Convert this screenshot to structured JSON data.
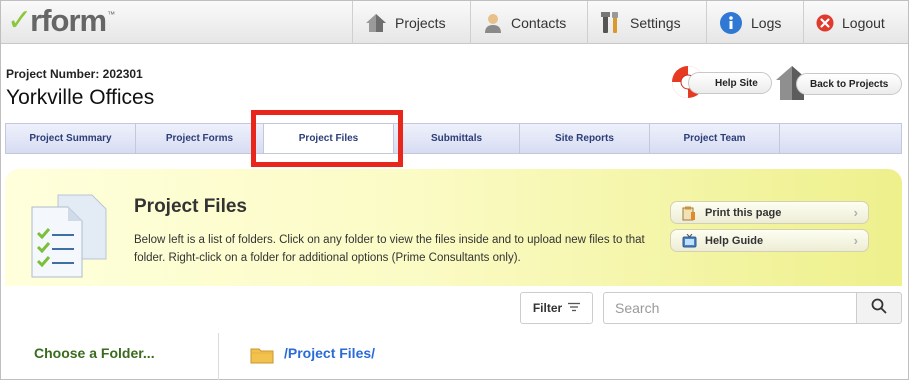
{
  "app": {
    "logo_text": "rform",
    "logo_tm": "™"
  },
  "nav": {
    "items": [
      {
        "label": "Projects",
        "icon": "house-icon"
      },
      {
        "label": "Contacts",
        "icon": "user-icon"
      },
      {
        "label": "Settings",
        "icon": "tools-icon"
      },
      {
        "label": "Logs",
        "icon": "info-icon"
      },
      {
        "label": "Logout",
        "icon": "close-circle-icon"
      }
    ]
  },
  "project": {
    "number_label": "Project Number: 202301",
    "name": "Yorkville Offices"
  },
  "header_buttons": {
    "help_site": "Help Site",
    "back_to_projects": "Back to Projects"
  },
  "tabs": [
    {
      "label": "Project Summary"
    },
    {
      "label": "Project Forms"
    },
    {
      "label": "Project Files",
      "active": true
    },
    {
      "label": "Submittals"
    },
    {
      "label": "Site Reports"
    },
    {
      "label": "Project Team"
    }
  ],
  "panel": {
    "title": "Project Files",
    "description": "Below left is a list of folders. Click on any folder to view the files inside and to upload new files to that folder. Right-click on a folder for additional options (Prime Consultants only).",
    "print_label": "Print this page",
    "guide_label": "Help Guide"
  },
  "toolbar": {
    "filter_label": "Filter",
    "search_placeholder": "Search"
  },
  "folders": {
    "choose_label": "Choose a Folder...",
    "current_path": "/Project Files/"
  },
  "colors": {
    "highlight": "#e8261c",
    "tab_text": "#2c3d78",
    "folder_heading": "#3a6b1e",
    "path_link": "#2a6bd8"
  }
}
